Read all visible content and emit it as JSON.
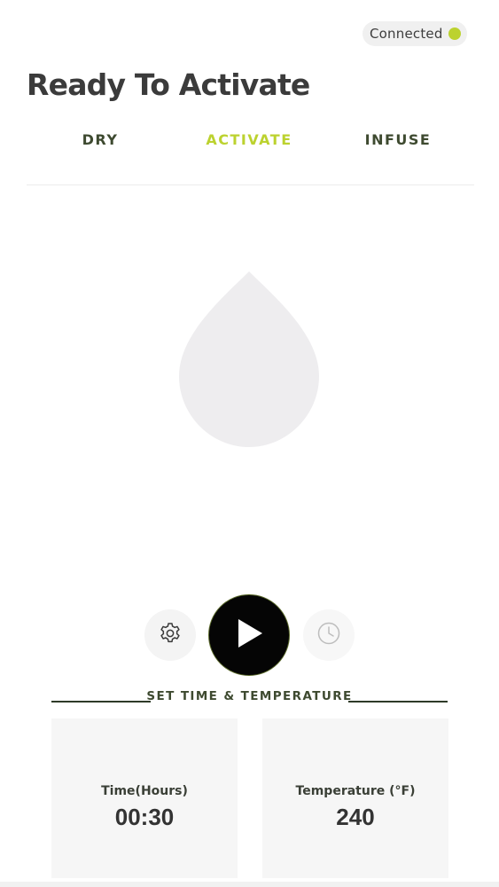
{
  "status": {
    "label": "Connected",
    "dot_color": "#bcd22f"
  },
  "page_title": "Ready To Activate",
  "tabs": [
    {
      "label": "DRY",
      "active": false
    },
    {
      "label": "ACTIVATE",
      "active": true
    },
    {
      "label": "INFUSE",
      "active": false
    }
  ],
  "hero": {
    "icon": "drop-icon",
    "color": "#eeedef"
  },
  "controls": {
    "settings_icon": "gear-icon",
    "play_icon": "play-icon",
    "history_icon": "clock-icon"
  },
  "settings_section": {
    "heading": "SET TIME & TEMPERATURE",
    "time": {
      "label": "Time(Hours)",
      "value": "00:30"
    },
    "temperature": {
      "label": "Temperature (°F)",
      "value": "240"
    }
  },
  "colors": {
    "accent": "#bcd22f",
    "tab_text": "#3e4a30",
    "title": "#3b3b3b"
  }
}
